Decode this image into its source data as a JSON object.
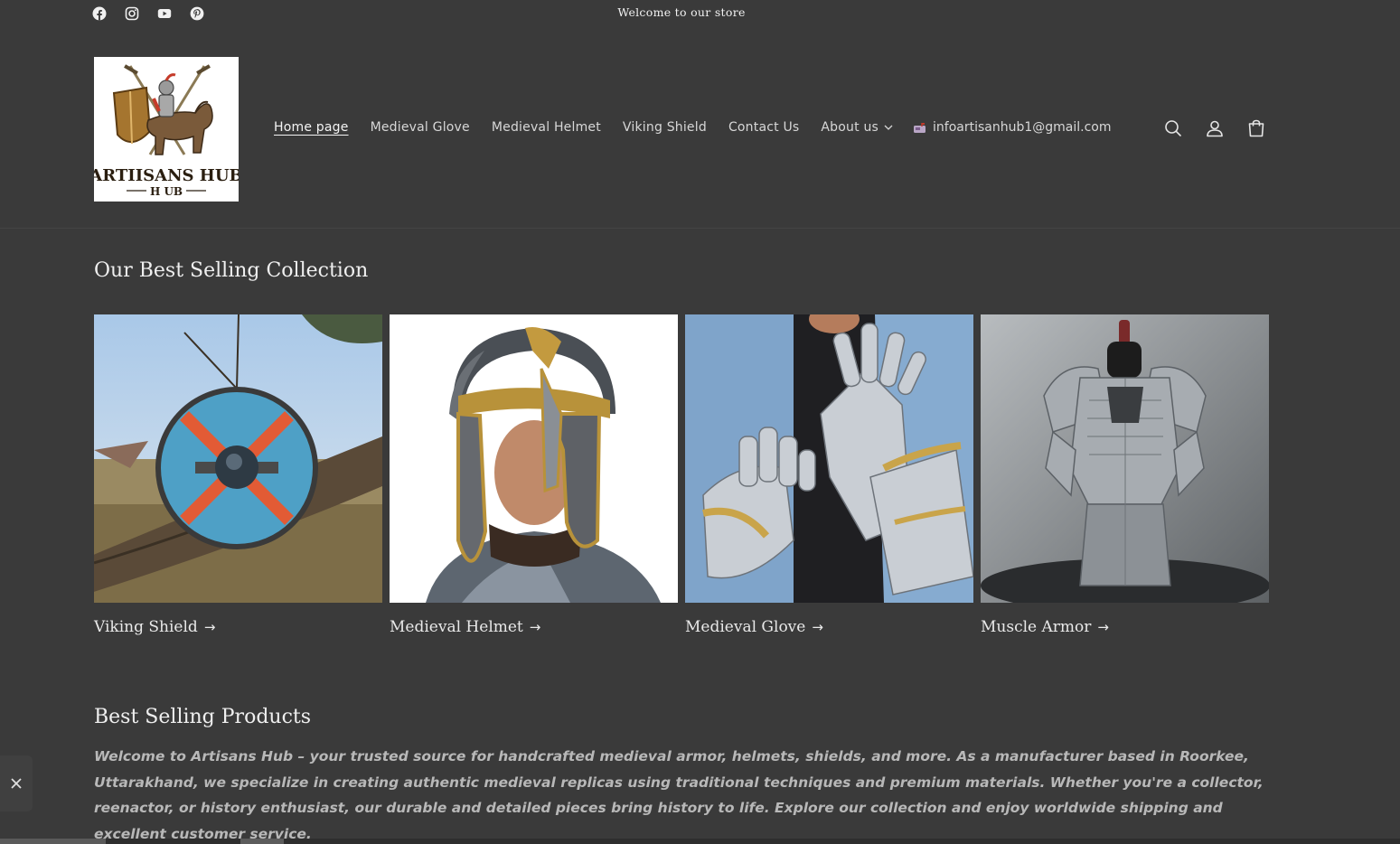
{
  "announcement": {
    "text": "Welcome to our store"
  },
  "social": [
    {
      "icon": "facebook-icon"
    },
    {
      "icon": "instagram-icon"
    },
    {
      "icon": "youtube-icon"
    },
    {
      "icon": "pinterest-icon"
    }
  ],
  "header": {
    "logo": {
      "line1": "ARTIISANS HUB",
      "line2": "H UB"
    },
    "nav": [
      {
        "label": "Home page",
        "active": true
      },
      {
        "label": "Medieval Glove"
      },
      {
        "label": "Medieval Helmet"
      },
      {
        "label": "Viking Shield"
      },
      {
        "label": "Contact Us"
      },
      {
        "label": "About us",
        "has_dropdown": true
      }
    ],
    "email": "infoartisanhub1@gmail.com",
    "icons": [
      "search-icon",
      "account-icon",
      "cart-icon"
    ]
  },
  "collection": {
    "title": "Our Best Selling Collection",
    "cards": [
      {
        "label": "Viking Shield"
      },
      {
        "label": "Medieval Helmet"
      },
      {
        "label": "Medieval Glove"
      },
      {
        "label": "Muscle Armor"
      }
    ]
  },
  "products": {
    "title": "Best Selling Products",
    "description": "Welcome to Artisans Hub – your trusted source for handcrafted medieval armor, helmets, shields, and more. As a manufacturer based in Roorkee, Uttarakhand, we specialize in creating authentic medieval replicas using traditional techniques and premium materials. Whether you're a collector, reenactor, or history enthusiast, our durable and detailed pieces bring history to life. Explore our collection and enjoy worldwide shipping and excellent customer service."
  },
  "colors": {
    "background": "#3a3a3a",
    "text": "#e8e8e8",
    "muted_text": "#b8b8b8"
  }
}
